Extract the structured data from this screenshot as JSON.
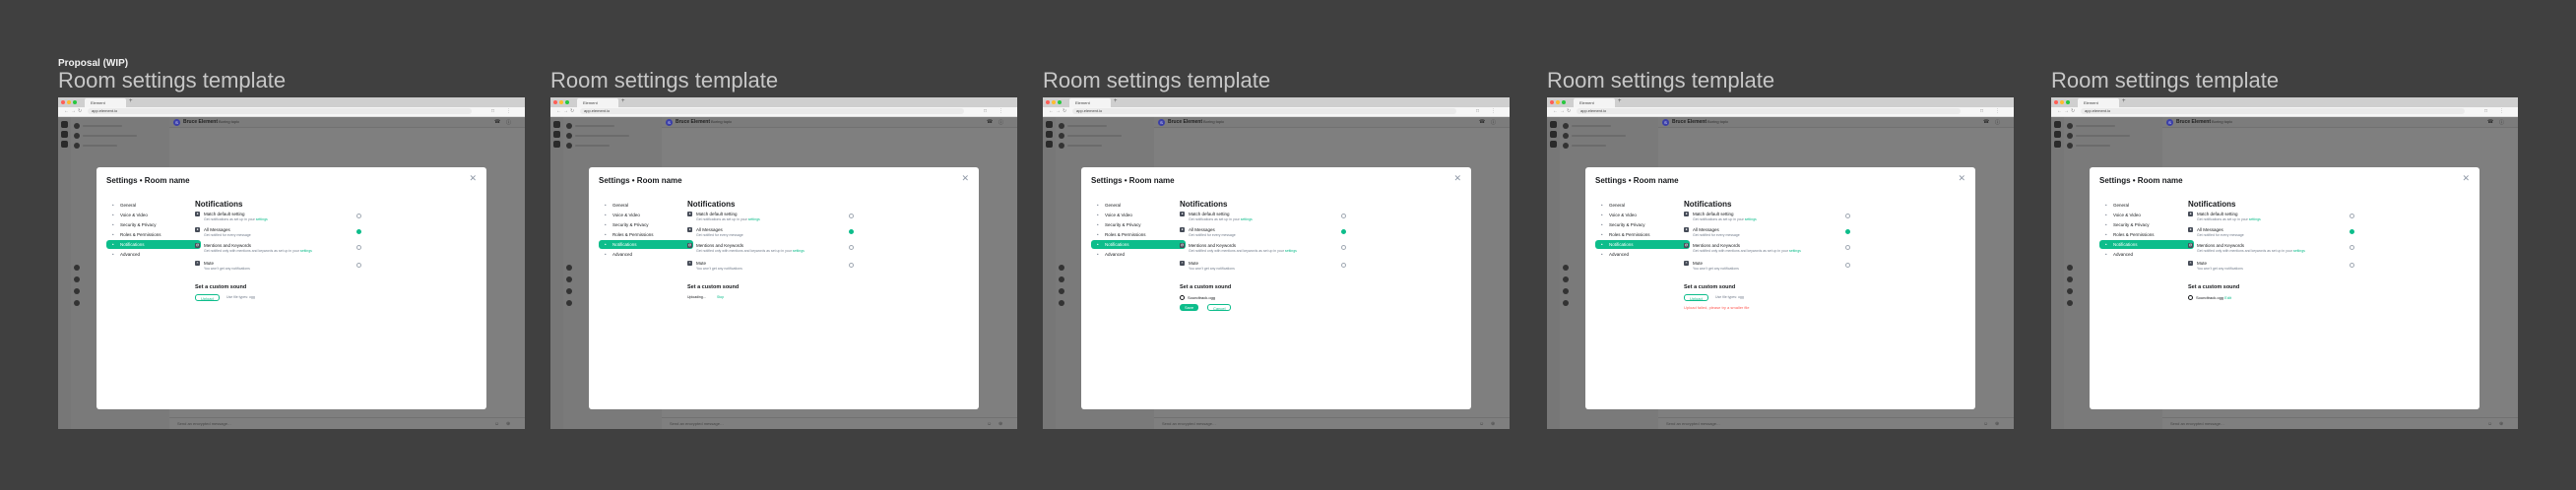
{
  "canvas_title": "Proposal (WIP)",
  "frame_title": "Room settings template",
  "browser": {
    "tab_label": "Element",
    "url": "app.element.io"
  },
  "room_header": {
    "avatar_letter": "S",
    "name": "Bruce Element",
    "subtitle": "Boring topic"
  },
  "composer": {
    "placeholder": "Send an encrypted message…"
  },
  "modal": {
    "title": "Settings • Room name",
    "nav": [
      "General",
      "Voice & Video",
      "Security & Privacy",
      "Roles & Permissions",
      "Notifications",
      "Advanced"
    ],
    "section_title": "Notifications",
    "options": [
      {
        "title": "Match default setting",
        "desc": "Get notifications as set up in your",
        "link": "settings",
        "checked": false
      },
      {
        "title": "All Messages",
        "desc": "Get notified for every message",
        "checked": true
      },
      {
        "title": "Mentions and Keywords",
        "desc": "Get notified only with mentions and keywords as set up in your",
        "link": "settings",
        "checked": false
      },
      {
        "title": "Mute",
        "desc": "You won't get any notifications",
        "checked": false
      }
    ],
    "sound_title": "Set a custom sound"
  },
  "states": {
    "upload_label": "Upload",
    "upload_hint": "Use file types: ogg",
    "uploading_text": "Uploading...",
    "uploading_cancel": "Stop",
    "file_name": "Soundtrack.ogg",
    "file_link": "Edit",
    "save_label": "Save",
    "cancel_label": "Cancel",
    "error_text": "Upload failed, please try a smaller file"
  },
  "colors": {
    "accent": "#0dbd8b",
    "error": "#ff5b55",
    "canvas": "#404040"
  },
  "icons": {
    "close": "close-icon",
    "bell": "bell-icon",
    "mute": "mute-icon"
  }
}
